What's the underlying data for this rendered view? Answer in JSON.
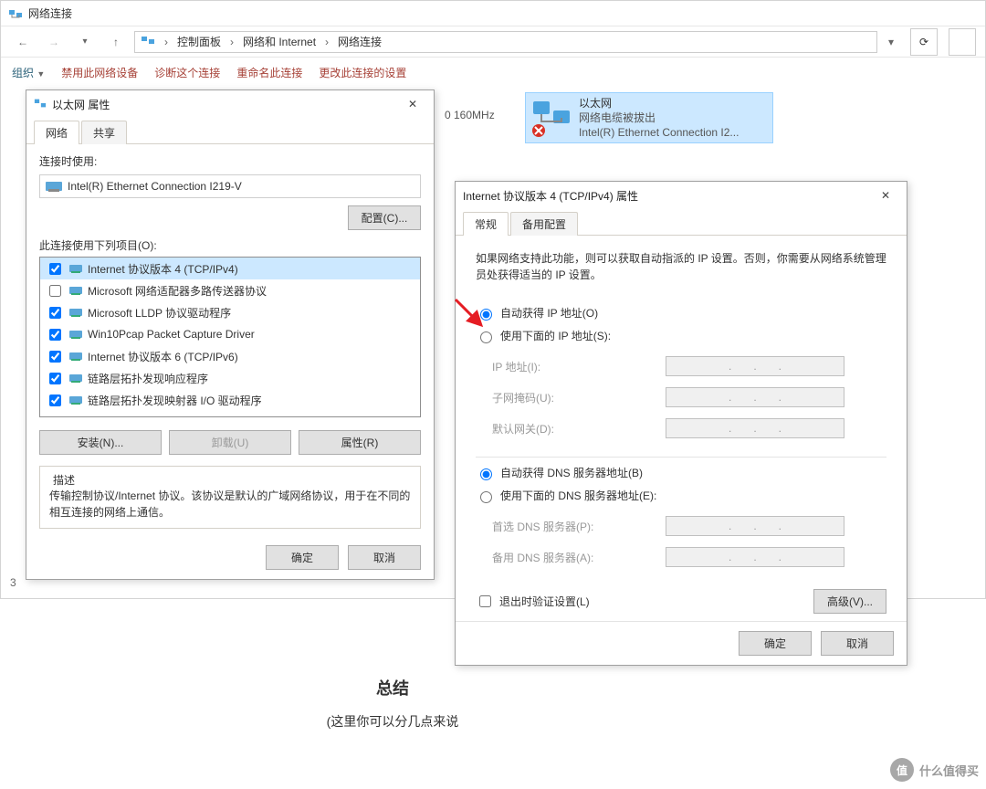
{
  "explorer": {
    "title": "网络连接",
    "breadcrumb": [
      "控制面板",
      "网络和 Internet",
      "网络连接"
    ],
    "commands": {
      "organize": "组织",
      "disable": "禁用此网络设备",
      "diagnose": "诊断这个连接",
      "rename": "重命名此连接",
      "change_settings": "更改此连接的设置"
    },
    "freq_hint": "0 160MHz",
    "adapter": {
      "name": "以太网",
      "status": "网络电缆被拔出",
      "device": "Intel(R) Ethernet Connection I2..."
    },
    "item_count": "3"
  },
  "ethernet_props": {
    "title": "以太网 属性",
    "tabs": {
      "network": "网络",
      "share": "共享"
    },
    "connect_using_label": "连接时使用:",
    "adapter_name": "Intel(R) Ethernet Connection I219-V",
    "configure_btn": "配置(C)...",
    "uses_items_label": "此连接使用下列项目(O):",
    "items": [
      {
        "checked": true,
        "label": "Internet 协议版本 4 (TCP/IPv4)",
        "selected": true
      },
      {
        "checked": false,
        "label": "Microsoft 网络适配器多路传送器协议"
      },
      {
        "checked": true,
        "label": "Microsoft LLDP 协议驱动程序"
      },
      {
        "checked": true,
        "label": "Win10Pcap Packet Capture Driver"
      },
      {
        "checked": true,
        "label": "Internet 协议版本 6 (TCP/IPv6)"
      },
      {
        "checked": true,
        "label": "链路层拓扑发现响应程序"
      },
      {
        "checked": true,
        "label": "链路层拓扑发现映射器 I/O 驱动程序"
      }
    ],
    "install_btn": "安装(N)...",
    "uninstall_btn": "卸载(U)",
    "properties_btn": "属性(R)",
    "desc_label": "描述",
    "desc_text": "传输控制协议/Internet 协议。该协议是默认的广域网络协议，用于在不同的相互连接的网络上通信。",
    "ok_btn": "确定",
    "cancel_btn": "取消"
  },
  "ipv4": {
    "title": "Internet 协议版本 4 (TCP/IPv4) 属性",
    "tabs": {
      "general": "常规",
      "alternate": "备用配置"
    },
    "intro": "如果网络支持此功能，则可以获取自动指派的 IP 设置。否则，你需要从网络系统管理员处获得适当的 IP 设置。",
    "radio_auto_ip": "自动获得 IP 地址(O)",
    "radio_manual_ip": "使用下面的 IP 地址(S):",
    "ip_addr_label": "IP 地址(I):",
    "subnet_label": "子网掩码(U):",
    "gateway_label": "默认网关(D):",
    "radio_auto_dns": "自动获得 DNS 服务器地址(B)",
    "radio_manual_dns": "使用下面的 DNS 服务器地址(E):",
    "dns1_label": "首选 DNS 服务器(P):",
    "dns2_label": "备用 DNS 服务器(A):",
    "validate_label": "退出时验证设置(L)",
    "advanced_btn": "高级(V)...",
    "ok_btn": "确定",
    "cancel_btn": "取消"
  },
  "article": {
    "heading": "总结",
    "body": "(这里你可以分几点来说"
  },
  "watermark": "什么值得买"
}
